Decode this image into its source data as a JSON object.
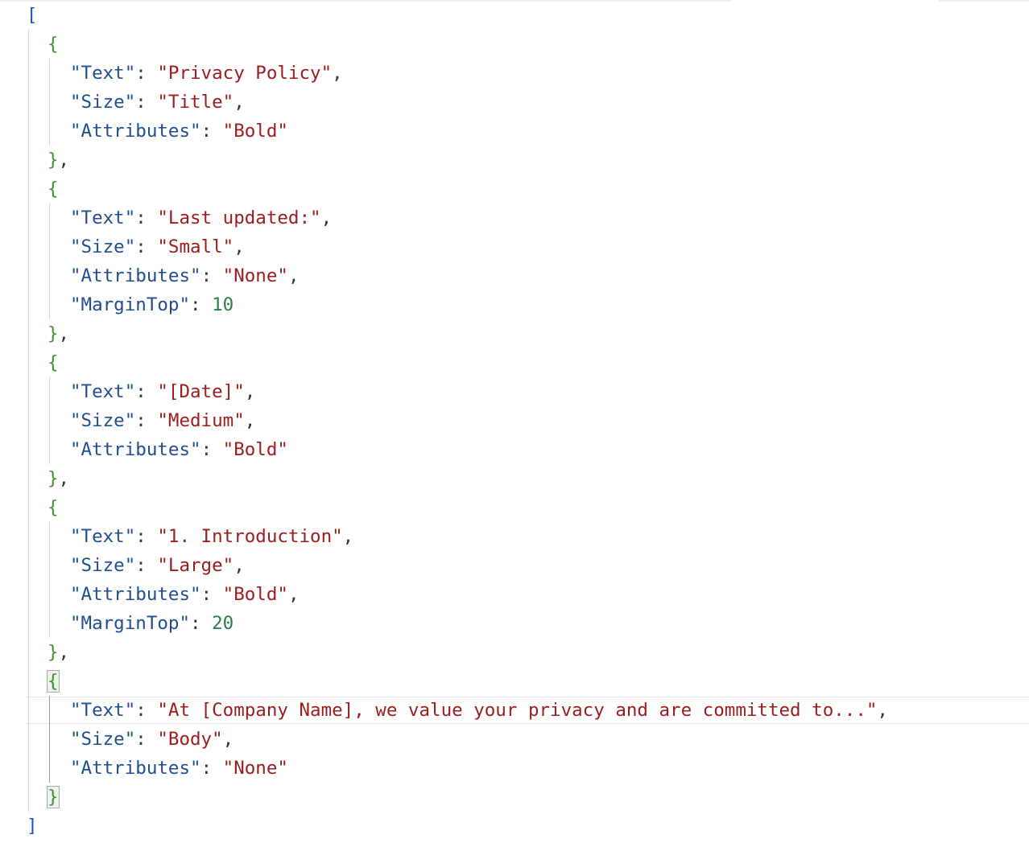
{
  "editor": {
    "open_bracket": "[",
    "close_bracket": "]",
    "open_brace": "{",
    "close_brace": "}",
    "items": [
      {
        "fields": [
          {
            "key": "\"Text\"",
            "value": "\"Privacy Policy\"",
            "type": "string"
          },
          {
            "key": "\"Size\"",
            "value": "\"Title\"",
            "type": "string"
          },
          {
            "key": "\"Attributes\"",
            "value": "\"Bold\"",
            "type": "string"
          }
        ]
      },
      {
        "fields": [
          {
            "key": "\"Text\"",
            "value": "\"Last updated:\"",
            "type": "string"
          },
          {
            "key": "\"Size\"",
            "value": "\"Small\"",
            "type": "string"
          },
          {
            "key": "\"Attributes\"",
            "value": "\"None\"",
            "type": "string"
          },
          {
            "key": "\"MarginTop\"",
            "value": "10",
            "type": "number"
          }
        ]
      },
      {
        "fields": [
          {
            "key": "\"Text\"",
            "value": "\"[Date]\"",
            "type": "string"
          },
          {
            "key": "\"Size\"",
            "value": "\"Medium\"",
            "type": "string"
          },
          {
            "key": "\"Attributes\"",
            "value": "\"Bold\"",
            "type": "string"
          }
        ]
      },
      {
        "fields": [
          {
            "key": "\"Text\"",
            "value": "\"1. Introduction\"",
            "type": "string"
          },
          {
            "key": "\"Size\"",
            "value": "\"Large\"",
            "type": "string"
          },
          {
            "key": "\"Attributes\"",
            "value": "\"Bold\"",
            "type": "string"
          },
          {
            "key": "\"MarginTop\"",
            "value": "20",
            "type": "number"
          }
        ]
      },
      {
        "fields": [
          {
            "key": "\"Text\"",
            "value": "\"At [Company Name], we value your privacy and are committed to...\"",
            "type": "string"
          },
          {
            "key": "\"Size\"",
            "value": "\"Body\"",
            "type": "string"
          },
          {
            "key": "\"Attributes\"",
            "value": "\"None\"",
            "type": "string"
          }
        ]
      }
    ]
  },
  "colors": {
    "key": "#1f4d8f",
    "string": "#9b1c1c",
    "number": "#2e7d4f",
    "outer_bracket": "#1b4fd8",
    "object_brace": "#3f8f2f"
  }
}
